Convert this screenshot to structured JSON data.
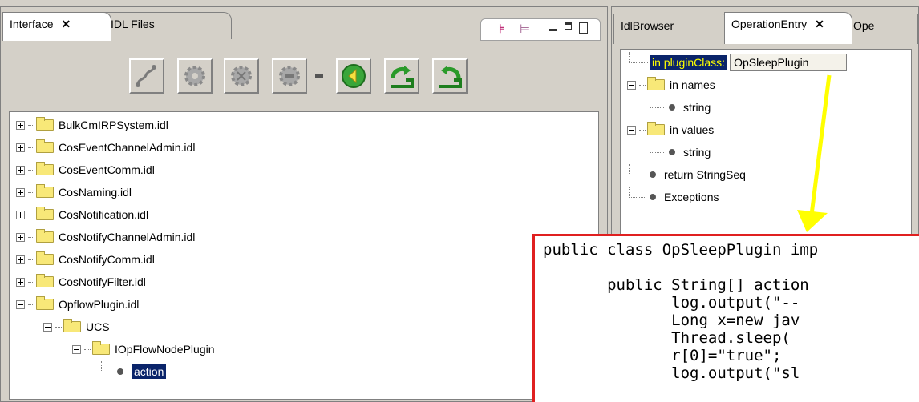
{
  "left_view": {
    "tabs": [
      {
        "label": "Interface",
        "close": "✕"
      },
      {
        "label": "IDL Files"
      }
    ],
    "icons": [
      "hierarchy-icon",
      "tree-view-icon",
      "minimize-icon",
      "maximize-icon",
      "restore-icon"
    ],
    "toolbar": [
      "connect-icon",
      "gear-icon",
      "gear-add-icon",
      "gear-remove-icon",
      "play-icon",
      "refresh-icon",
      "reload-icon"
    ],
    "tree": [
      {
        "label": "BulkCmIRPSystem.idl",
        "expander": "+"
      },
      {
        "label": "CosEventChannelAdmin.idl",
        "expander": "+"
      },
      {
        "label": "CosEventComm.idl",
        "expander": "+"
      },
      {
        "label": "CosNaming.idl",
        "expander": "+"
      },
      {
        "label": "CosNotification.idl",
        "expander": "+"
      },
      {
        "label": "CosNotifyChannelAdmin.idl",
        "expander": "+"
      },
      {
        "label": "CosNotifyComm.idl",
        "expander": "+"
      },
      {
        "label": "CosNotifyFilter.idl",
        "expander": "+"
      },
      {
        "label": "OpflowPlugin.idl",
        "expander": "-"
      },
      {
        "label": "UCS",
        "expander": "-"
      },
      {
        "label": "IOpFlowNodePlugin",
        "expander": "-"
      },
      {
        "label": "action",
        "selected": true
      }
    ]
  },
  "right_view": {
    "tabs": [
      {
        "label": "IdlBrowser"
      },
      {
        "label": "OperationEntry",
        "close": "✕"
      },
      {
        "label": "Ope"
      }
    ],
    "plugin_class": {
      "label": "in pluginClass:",
      "value": "OpSleepPlugin"
    },
    "tree": [
      {
        "label": "in names"
      },
      {
        "label": "string"
      },
      {
        "label": "in values"
      },
      {
        "label": "string"
      },
      {
        "label": "return StringSeq"
      },
      {
        "label": "Exceptions"
      }
    ]
  },
  "code": {
    "lines": [
      "public class OpSleepPlugin imp",
      "",
      "       public String[] action",
      "              log.output(\"--",
      "              Long x=new jav",
      "              Thread.sleep(",
      "              r[0]=\"true\";",
      "              log.output(\"sl"
    ]
  },
  "colors": {
    "selection": "#0a246a",
    "arrow": "#ffff00",
    "code_border": "#e02020"
  }
}
